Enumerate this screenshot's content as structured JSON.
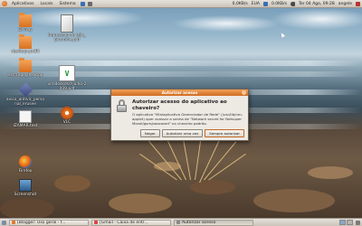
{
  "top_panel": {
    "menus": [
      "Aplicativos",
      "Locais",
      "Sistema"
    ],
    "tray_items": [
      "0,0KB/s",
      "EUA",
      "0.0KB/s",
      "Ter 04 Ago, 09:28",
      "angele"
    ]
  },
  "desktop_icons": [
    {
      "label": "DirTray",
      "type": "folder"
    },
    {
      "label": "desktop-pt-BR",
      "type": "folder"
    },
    {
      "label": "estrange_desktop",
      "type": "folder"
    },
    {
      "label": "aviso_antivir_personal_erusee",
      "type": "diamond"
    },
    {
      "label": "IZAMAR.text",
      "type": "doc"
    },
    {
      "label": "Firefox",
      "type": "firefox"
    },
    {
      "label": "Screenshot",
      "type": "screen"
    },
    {
      "label": "Impressao de tela_piramide.pdf",
      "type": "iconset"
    },
    {
      "label": "vimdoskdsd-julho-2009.pdf",
      "type": "vim"
    },
    {
      "label": "VLC",
      "type": "media"
    }
  ],
  "dialog": {
    "window_title": "Autorizar acesso",
    "heading": "Autorizar acesso do aplicativo ao chaveiro?",
    "message": "O aplicativo \"Miniaplicativo Gerenciador de Rede\" (/usr/lib/nm-applet) quer acessar a senha de \"Network secret for Netsuper Movel/gsm/password\" no chaveiro padrão.",
    "buttons": {
      "deny": "Negar",
      "allow_once": "Autorizar uma vez",
      "always_allow": "Sempre autorizar"
    }
  },
  "taskbar": {
    "tasks": [
      {
        "label": "[Blogger: Uso geral - f...",
        "icon_color": "#e07a2a"
      },
      {
        "label": "[Gmail - Caixa de entr...",
        "icon_color": "#d44"
      },
      {
        "label": "Autorizar acesso",
        "icon_color": "#888",
        "active": true
      }
    ]
  }
}
